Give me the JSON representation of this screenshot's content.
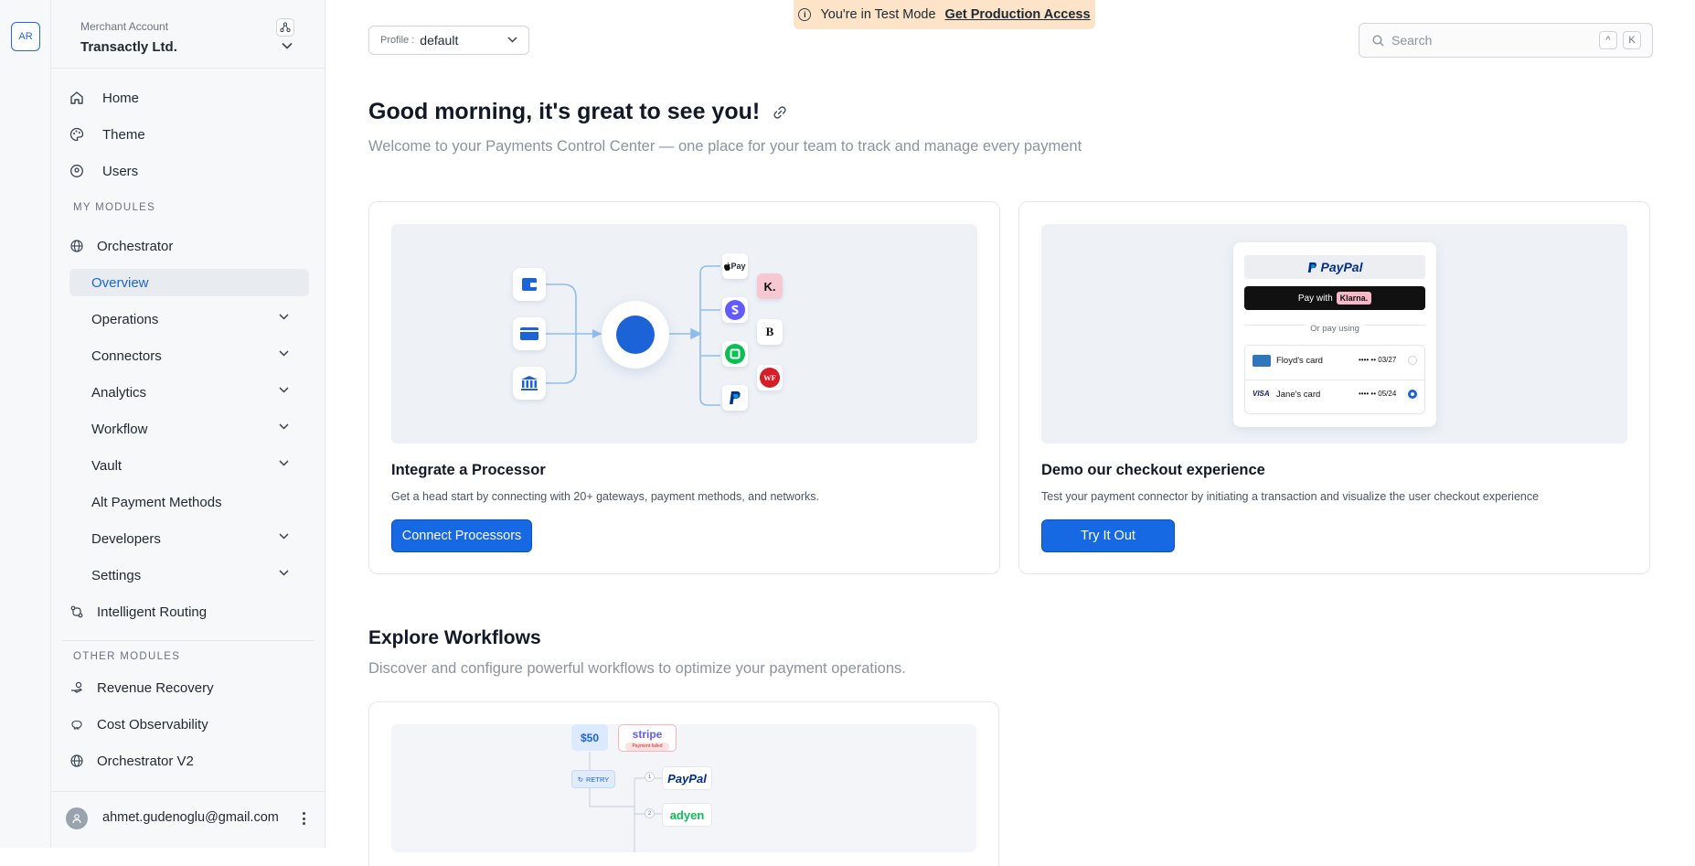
{
  "rail": {
    "avatar": "AR"
  },
  "merchant": {
    "label": "Merchant Account",
    "name": "Transactly Ltd."
  },
  "nav": {
    "home": "Home",
    "theme": "Theme",
    "users": "Users",
    "my_modules": "MY MODULES",
    "orchestrator": "Orchestrator",
    "overview": "Overview",
    "operations": "Operations",
    "connectors": "Connectors",
    "analytics": "Analytics",
    "workflow": "Workflow",
    "vault": "Vault",
    "alt_payment_methods": "Alt Payment Methods",
    "developers": "Developers",
    "settings": "Settings",
    "intelligent_routing": "Intelligent Routing",
    "other_modules": "OTHER MODULES",
    "revenue_recovery": "Revenue Recovery",
    "cost_observability": "Cost Observability",
    "orchestrator_v2": "Orchestrator V2"
  },
  "user": {
    "email": "ahmet.gudenoglu@gmail.com"
  },
  "banner": {
    "text": "You're in Test Mode",
    "link": "Get Production Access"
  },
  "profile": {
    "label": "Profile :",
    "value": "default"
  },
  "search": {
    "placeholder": "Search",
    "key1": "^",
    "key2": "K"
  },
  "greeting": {
    "title": "Good morning, it's great to see you!",
    "subtitle": "Welcome to your Payments Control Center — one place for your team to track and manage every payment"
  },
  "cards": {
    "integrate": {
      "title": "Integrate a Processor",
      "desc": "Get a head start by connecting with 20+ gateways, payment methods, and networks.",
      "button": "Connect Processors",
      "logos": {
        "apple_pay": "Pay",
        "klarna": "K.",
        "b": "B",
        "wf": "WF"
      }
    },
    "demo": {
      "title": "Demo our checkout experience",
      "desc": "Test your payment connector by initiating a transaction and visualize the user checkout experience",
      "button": "Try It Out",
      "checkout": {
        "paypal": "PayPal",
        "pay_with": "Pay with",
        "klarna": "Klarna.",
        "or_pay_using": "Or pay using",
        "card1_name": "Floyd's card",
        "card1_num": "•••• •• 03/27",
        "card2_brand": "VISA",
        "card2_name": "Jane's card",
        "card2_num": "•••• •• 05/24"
      }
    }
  },
  "workflows": {
    "title": "Explore Workflows",
    "subtitle": "Discover and configure powerful workflows to optimize your payment operations.",
    "art": {
      "amount": "$50",
      "stripe": "stripe",
      "failed": "Payment failed",
      "retry": "RETRY",
      "paypal": "PayPal",
      "adyen": "adyen",
      "step1": "1",
      "step2": "2"
    }
  },
  "colors": {
    "accent": "#1668e3",
    "banner": "#fde4c8"
  }
}
